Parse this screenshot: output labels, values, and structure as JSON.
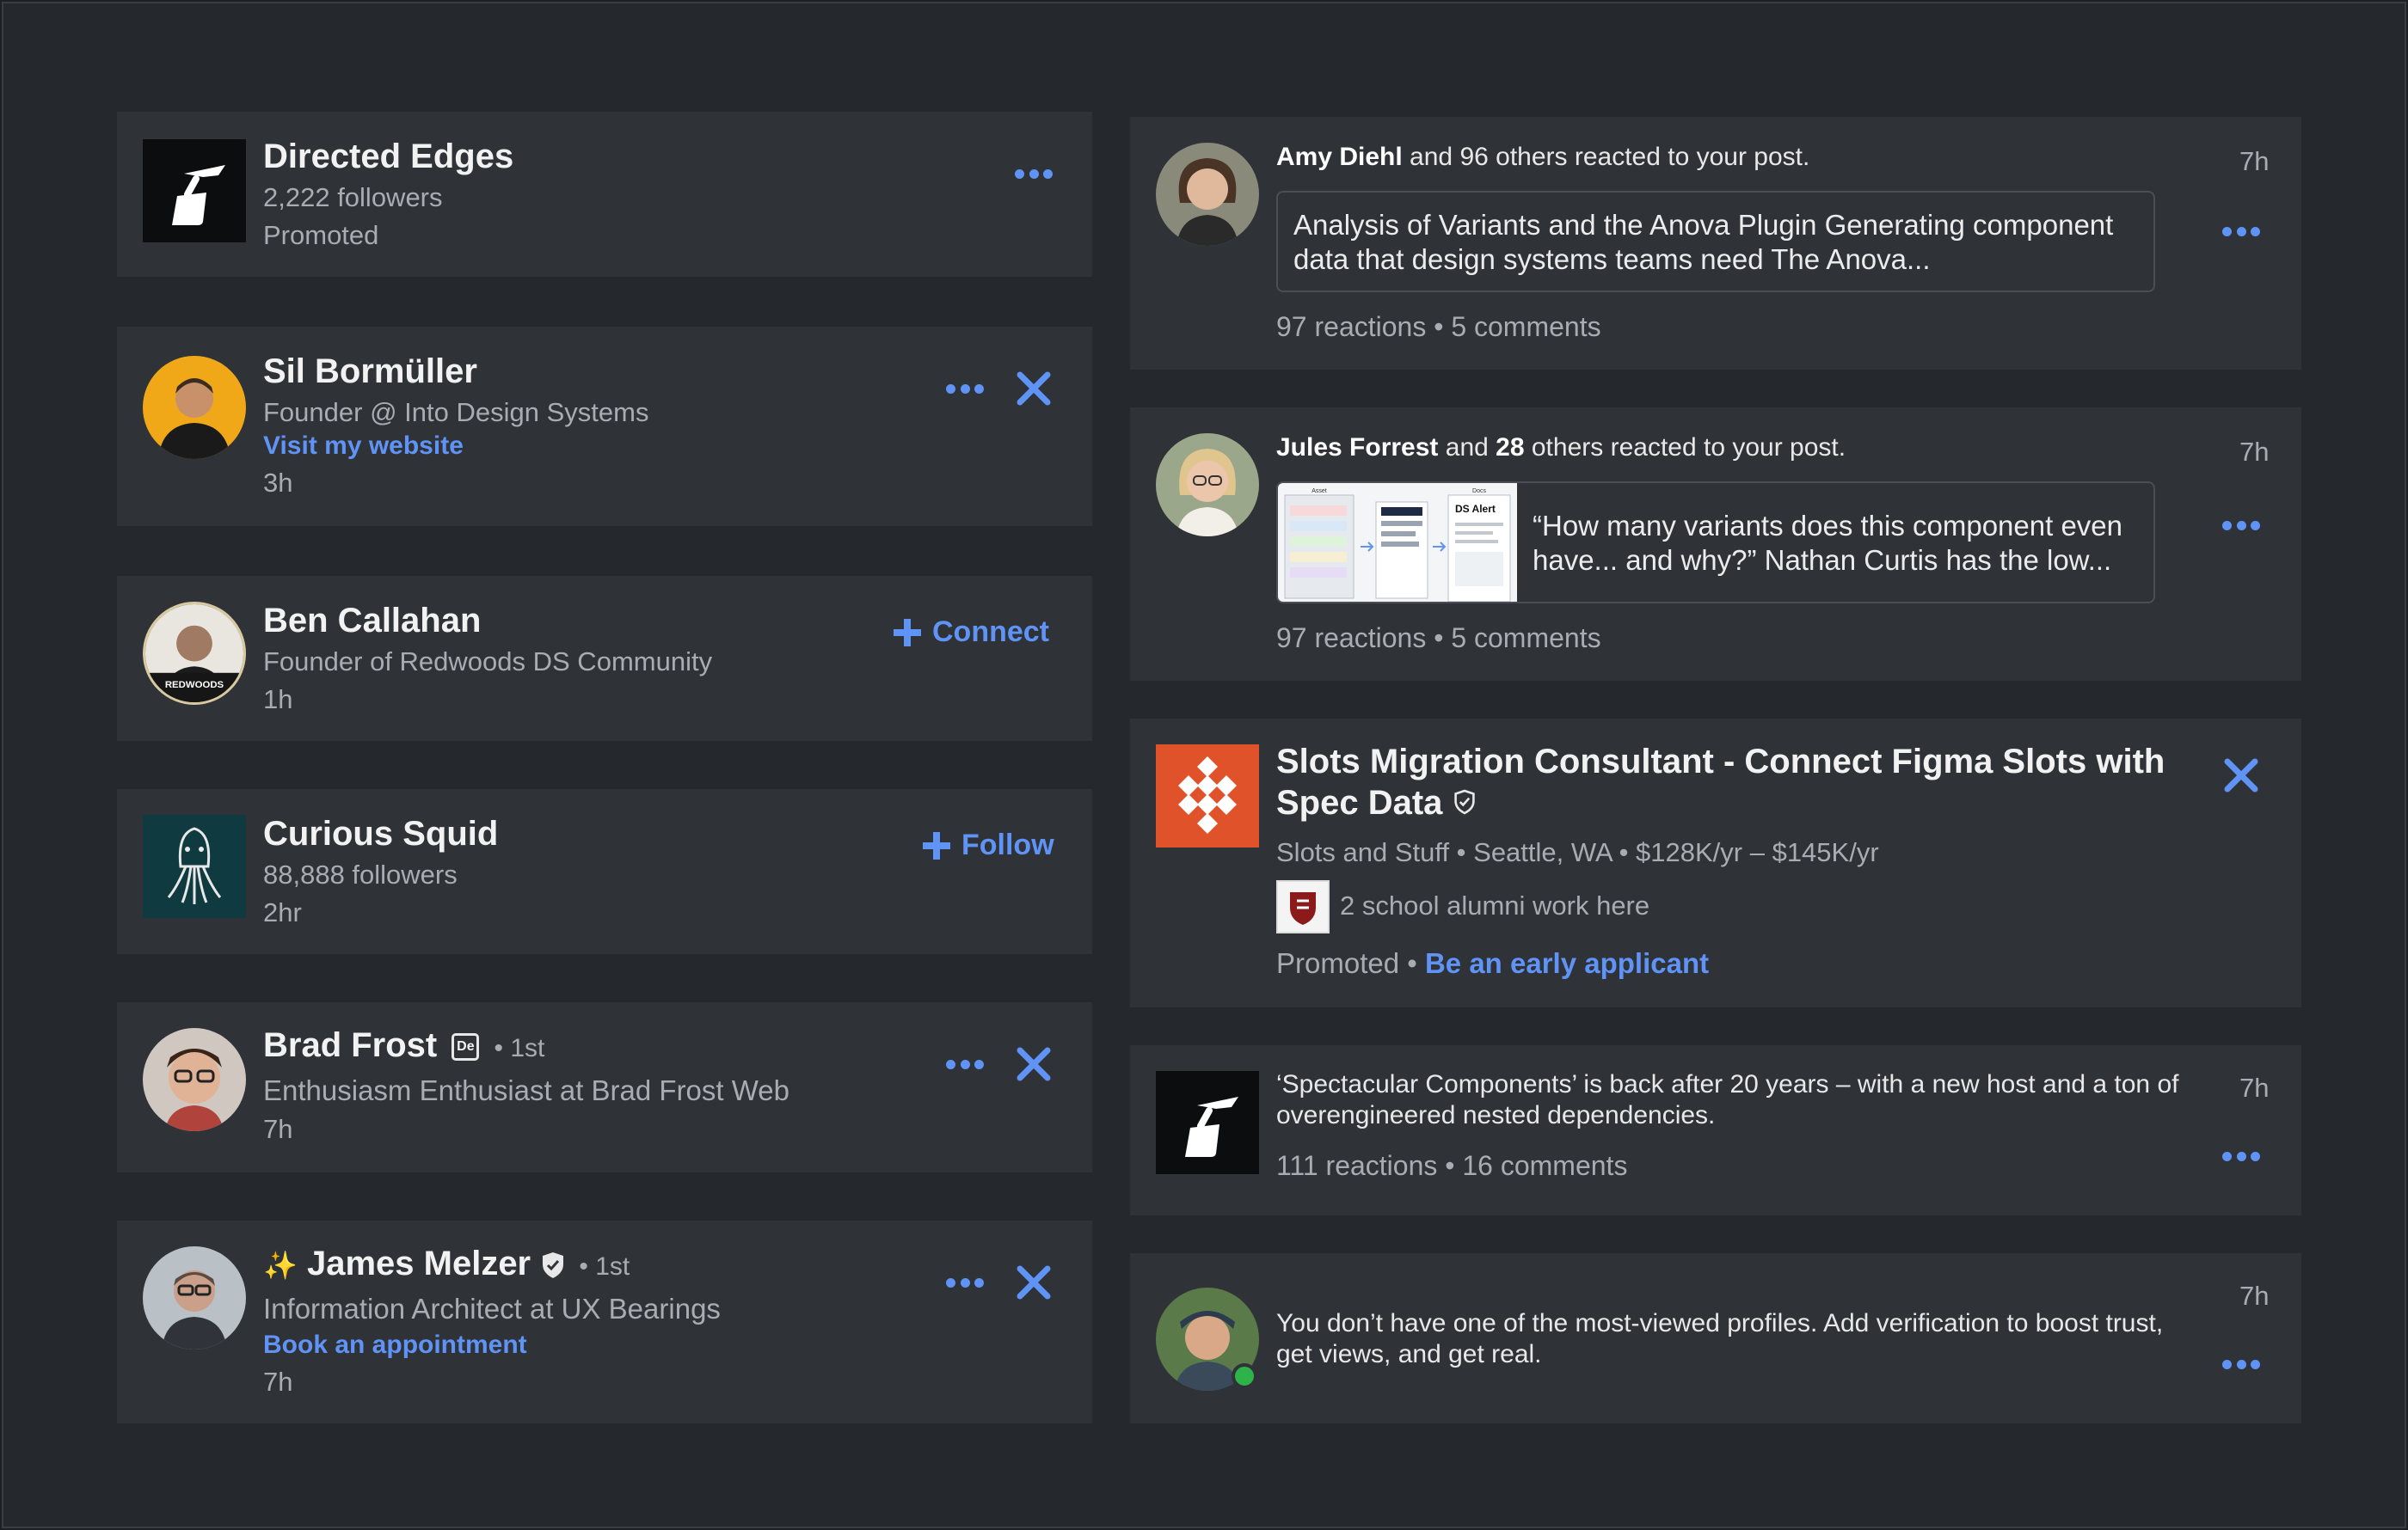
{
  "left_feed": [
    {
      "name": "Directed Edges",
      "line1": "2,222 followers",
      "line2": "Promoted"
    },
    {
      "name": "Sil Bormüller",
      "line1": "Founder @ Into Design Systems",
      "link": "Visit my website",
      "time": "3h"
    },
    {
      "name": "Ben Callahan",
      "line1": "Founder of Redwoods DS Community",
      "time": "1h",
      "action": "Connect",
      "logo_text": "REDWOODS"
    },
    {
      "name": "Curious Squid",
      "line1": "88,888 followers",
      "time": "2hr",
      "action": "Follow"
    },
    {
      "name": "Brad Frost",
      "degree": "• 1st",
      "badge": "De",
      "line1": "Enthusiasm Enthusiast at Brad Frost Web",
      "time": "7h"
    },
    {
      "name": "James Melzer",
      "sparkle": "✨",
      "degree": "• 1st",
      "line1": "Information Architect at UX Bearings",
      "link": "Book an appointment",
      "time": "7h"
    }
  ],
  "right_feed": {
    "amy": {
      "actor": "Amy Diehl",
      "rest": " and 96 others reacted to your post.",
      "quote": "Analysis of Variants and the Anova Plugin Generating component data that design systems teams need The Anova...",
      "stats": "97 reactions • 5 comments",
      "time": "7h"
    },
    "jules": {
      "actor": "Jules Forrest",
      "mid": " and ",
      "count": "28",
      "rest": " others reacted to your post.",
      "quote": "“How many variants does this component even have... and why?” Nathan Curtis has the low...",
      "thumb_label1": "Asset",
      "thumb_label2": "Docs",
      "thumb_label3": "DS Alert",
      "stats": "97 reactions • 5 comments",
      "time": "7h"
    },
    "job": {
      "title": "Slots Migration Consultant - Connect Figma Slots with Spec Data",
      "details": "Slots and Stuff • Seattle, WA • $128K/yr – $145K/yr",
      "alumni": "2 school alumni work here",
      "promoted": "Promoted •",
      "apply": "Be an early applicant"
    },
    "spectacular": {
      "text": "‘Spectacular Components’ is back after 20 years – with a new host and a ton of overengineered nested dependencies.",
      "stats": "111 reactions • 16 comments",
      "time": "7h"
    },
    "verify": {
      "text": "You don’t have one of the most-viewed profiles. Add verification to boost trust, get views, and get real.",
      "time": "7h"
    }
  },
  "colors": {
    "accent": "#5f93f5",
    "card": "#2f3237",
    "background": "#25282d",
    "online": "#2db34a",
    "job_logo": "#e0532a"
  }
}
